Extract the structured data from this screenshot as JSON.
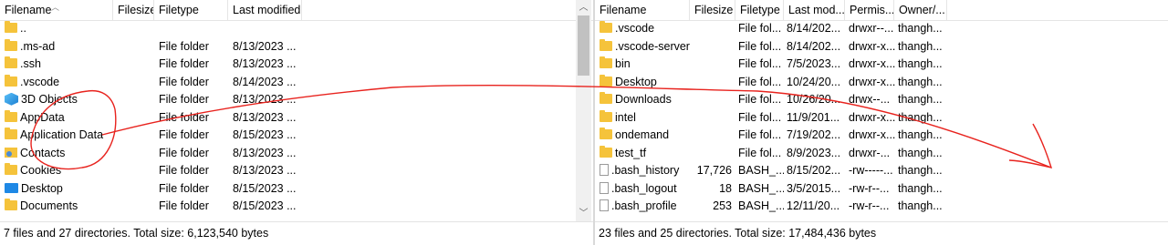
{
  "left_pane": {
    "headers": {
      "filename": "Filename",
      "filesize": "Filesize",
      "filetype": "Filetype",
      "last_modified": "Last modified"
    },
    "rows": [
      {
        "name": "..",
        "type": "",
        "modified": "",
        "icon": "folder-icon"
      },
      {
        "name": ".ms-ad",
        "type": "File folder",
        "modified": "8/13/2023 ...",
        "icon": "folder-icon"
      },
      {
        "name": ".ssh",
        "type": "File folder",
        "modified": "8/13/2023 ...",
        "icon": "folder-icon"
      },
      {
        "name": ".vscode",
        "type": "File folder",
        "modified": "8/14/2023 ...",
        "icon": "folder-icon"
      },
      {
        "name": "3D Objects",
        "type": "File folder",
        "modified": "8/13/2023 ...",
        "icon": "3d-objects-icon"
      },
      {
        "name": "AppData",
        "type": "File folder",
        "modified": "8/13/2023 ...",
        "icon": "folder-icon"
      },
      {
        "name": "Application Data",
        "type": "File folder",
        "modified": "8/15/2023 ...",
        "icon": "folder-icon"
      },
      {
        "name": "Contacts",
        "type": "File folder",
        "modified": "8/13/2023 ...",
        "icon": "contacts-icon"
      },
      {
        "name": "Cookies",
        "type": "File folder",
        "modified": "8/13/2023 ...",
        "icon": "folder-icon"
      },
      {
        "name": "Desktop",
        "type": "File folder",
        "modified": "8/15/2023 ...",
        "icon": "desktop-icon"
      },
      {
        "name": "Documents",
        "type": "File folder",
        "modified": "8/15/2023 ...",
        "icon": "folder-icon"
      }
    ],
    "status": "7 files and 27 directories. Total size: 6,123,540 bytes"
  },
  "right_pane": {
    "headers": {
      "filename": "Filename",
      "filesize": "Filesize",
      "filetype": "Filetype",
      "last_modified": "Last mod...",
      "permissions": "Permis...",
      "owner": "Owner/..."
    },
    "rows": [
      {
        "name": ".vscode",
        "size": "",
        "type": "File fol...",
        "modified": "8/14/202...",
        "perms": "drwxr--...",
        "owner": "thangh...",
        "icon": "folder-icon"
      },
      {
        "name": ".vscode-server",
        "size": "",
        "type": "File fol...",
        "modified": "8/14/202...",
        "perms": "drwxr-x...",
        "owner": "thangh...",
        "icon": "folder-icon"
      },
      {
        "name": "bin",
        "size": "",
        "type": "File fol...",
        "modified": "7/5/2023...",
        "perms": "drwxr-x...",
        "owner": "thangh...",
        "icon": "folder-icon"
      },
      {
        "name": "Desktop",
        "size": "",
        "type": "File fol...",
        "modified": "10/24/20...",
        "perms": "drwxr-x...",
        "owner": "thangh...",
        "icon": "folder-icon"
      },
      {
        "name": "Downloads",
        "size": "",
        "type": "File fol...",
        "modified": "10/26/20...",
        "perms": "drwx--...",
        "owner": "thangh...",
        "icon": "folder-icon"
      },
      {
        "name": "intel",
        "size": "",
        "type": "File fol...",
        "modified": "11/9/201...",
        "perms": "drwxr-x...",
        "owner": "thangh...",
        "icon": "folder-icon"
      },
      {
        "name": "ondemand",
        "size": "",
        "type": "File fol...",
        "modified": "7/19/202...",
        "perms": "drwxr-x...",
        "owner": "thangh...",
        "icon": "folder-icon"
      },
      {
        "name": "test_tf",
        "size": "",
        "type": "File fol...",
        "modified": "8/9/2023...",
        "perms": "drwxr-...",
        "owner": "thangh...",
        "icon": "folder-icon"
      },
      {
        "name": ".bash_history",
        "size": "17,726",
        "type": "BASH_...",
        "modified": "8/15/202...",
        "perms": "-rw-----...",
        "owner": "thangh...",
        "icon": "file-icon"
      },
      {
        "name": ".bash_logout",
        "size": "18",
        "type": "BASH_...",
        "modified": "3/5/2015...",
        "perms": "-rw-r--...",
        "owner": "thangh...",
        "icon": "file-icon"
      },
      {
        "name": ".bash_profile",
        "size": "253",
        "type": "BASH_...",
        "modified": "12/11/20...",
        "perms": "-rw-r--...",
        "owner": "thangh...",
        "icon": "file-icon"
      }
    ],
    "status": "23 files and 25 directories. Total size: 17,484,436 bytes"
  },
  "colors": {
    "annotation": "#e8231e",
    "folder": "#f5c33b",
    "scroll_thumb": "#c1c1c1"
  }
}
